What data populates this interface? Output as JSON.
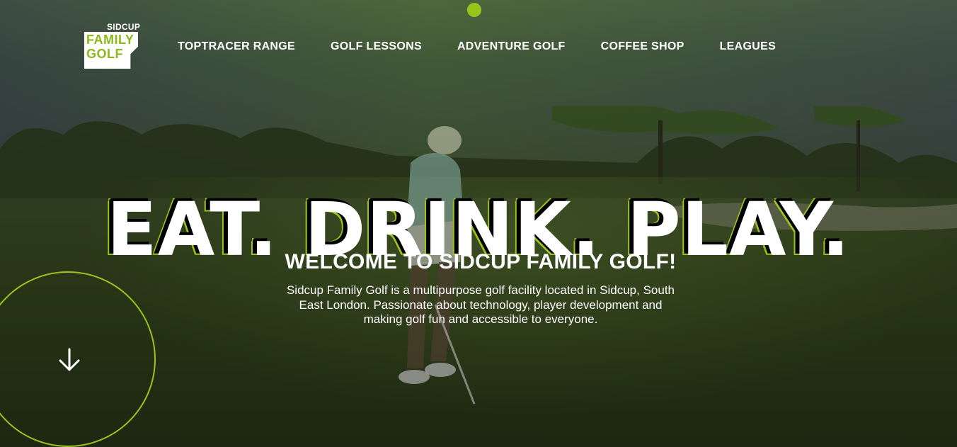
{
  "brand": {
    "logo_top": "SIDCUP",
    "logo_line1": "FAMILY",
    "logo_line2": "GOLF",
    "accent_color": "#9bc31d",
    "logo_text_color": "#8db81a"
  },
  "nav": {
    "items": [
      {
        "label": "TOPTRACER RANGE"
      },
      {
        "label": "GOLF LESSONS"
      },
      {
        "label": "ADVENTURE GOLF"
      },
      {
        "label": "COFFEE SHOP"
      },
      {
        "label": "LEAGUES"
      }
    ]
  },
  "hero": {
    "headline": "EAT. DRINK. PLAY.",
    "subheading": "WELCOME TO SIDCUP FAMILY GOLF!",
    "intro": "Sidcup Family Golf is a multipurpose golf facility located in Sidcup, South East London. Passionate about technology, player development and making golf fun and accessible to everyone.",
    "background_image": "golfer-on-fairway-photo"
  },
  "scroll": {
    "icon": "arrow-down-icon"
  }
}
